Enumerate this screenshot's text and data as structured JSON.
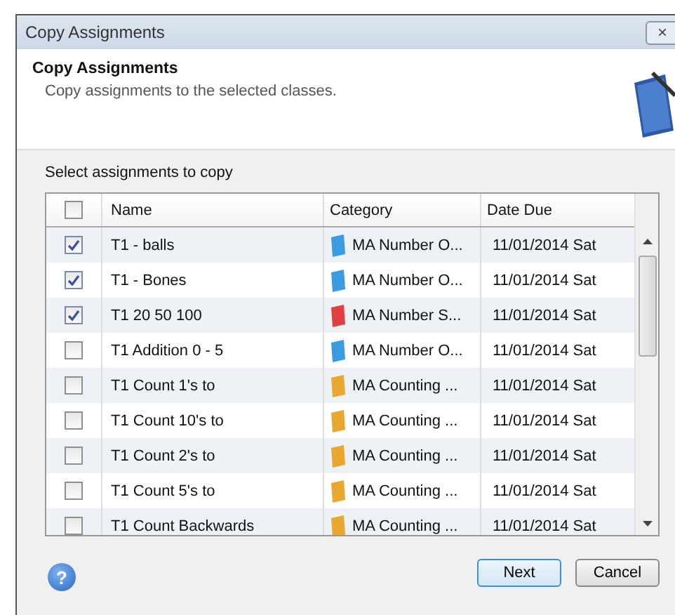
{
  "window": {
    "title": "Copy Assignments",
    "close": "×"
  },
  "header": {
    "title": "Copy Assignments",
    "subtitle": "Copy assignments to the selected classes."
  },
  "table": {
    "caption": "Select assignments to copy",
    "select_all": {
      "checked": false
    },
    "columns": [
      "Name",
      "Category",
      "Date Due"
    ],
    "rows": [
      {
        "checked": true,
        "name": "T1  - balls",
        "category": "MA Number O...",
        "color": "#3a9be0",
        "date": "11/01/2014 Sat"
      },
      {
        "checked": true,
        "name": "T1 - Bones",
        "category": "MA Number O...",
        "color": "#3a9be0",
        "date": "11/01/2014 Sat"
      },
      {
        "checked": true,
        "name": "T1 20 50 100",
        "category": "MA Number S...",
        "color": "#e04040",
        "date": "11/01/2014 Sat"
      },
      {
        "checked": false,
        "name": "T1 Addition 0 - 5",
        "category": "MA Number O...",
        "color": "#3a9be0",
        "date": "11/01/2014 Sat"
      },
      {
        "checked": false,
        "name": "T1 Count 1's to",
        "category": "MA Counting ...",
        "color": "#e8a830",
        "date": "11/01/2014 Sat"
      },
      {
        "checked": false,
        "name": "T1 Count 10's to",
        "category": "MA Counting ...",
        "color": "#e8a830",
        "date": "11/01/2014 Sat"
      },
      {
        "checked": false,
        "name": "T1 Count 2's to",
        "category": "MA Counting ...",
        "color": "#e8a830",
        "date": "11/01/2014 Sat"
      },
      {
        "checked": false,
        "name": "T1 Count 5's to",
        "category": "MA Counting ...",
        "color": "#e8a830",
        "date": "11/01/2014 Sat"
      },
      {
        "checked": false,
        "name": "T1 Count Backwards",
        "category": "MA Counting ...",
        "color": "#e8a830",
        "date": "11/01/2014 Sat"
      }
    ]
  },
  "buttons": {
    "help": "?",
    "next": "Next",
    "cancel": "Cancel"
  }
}
